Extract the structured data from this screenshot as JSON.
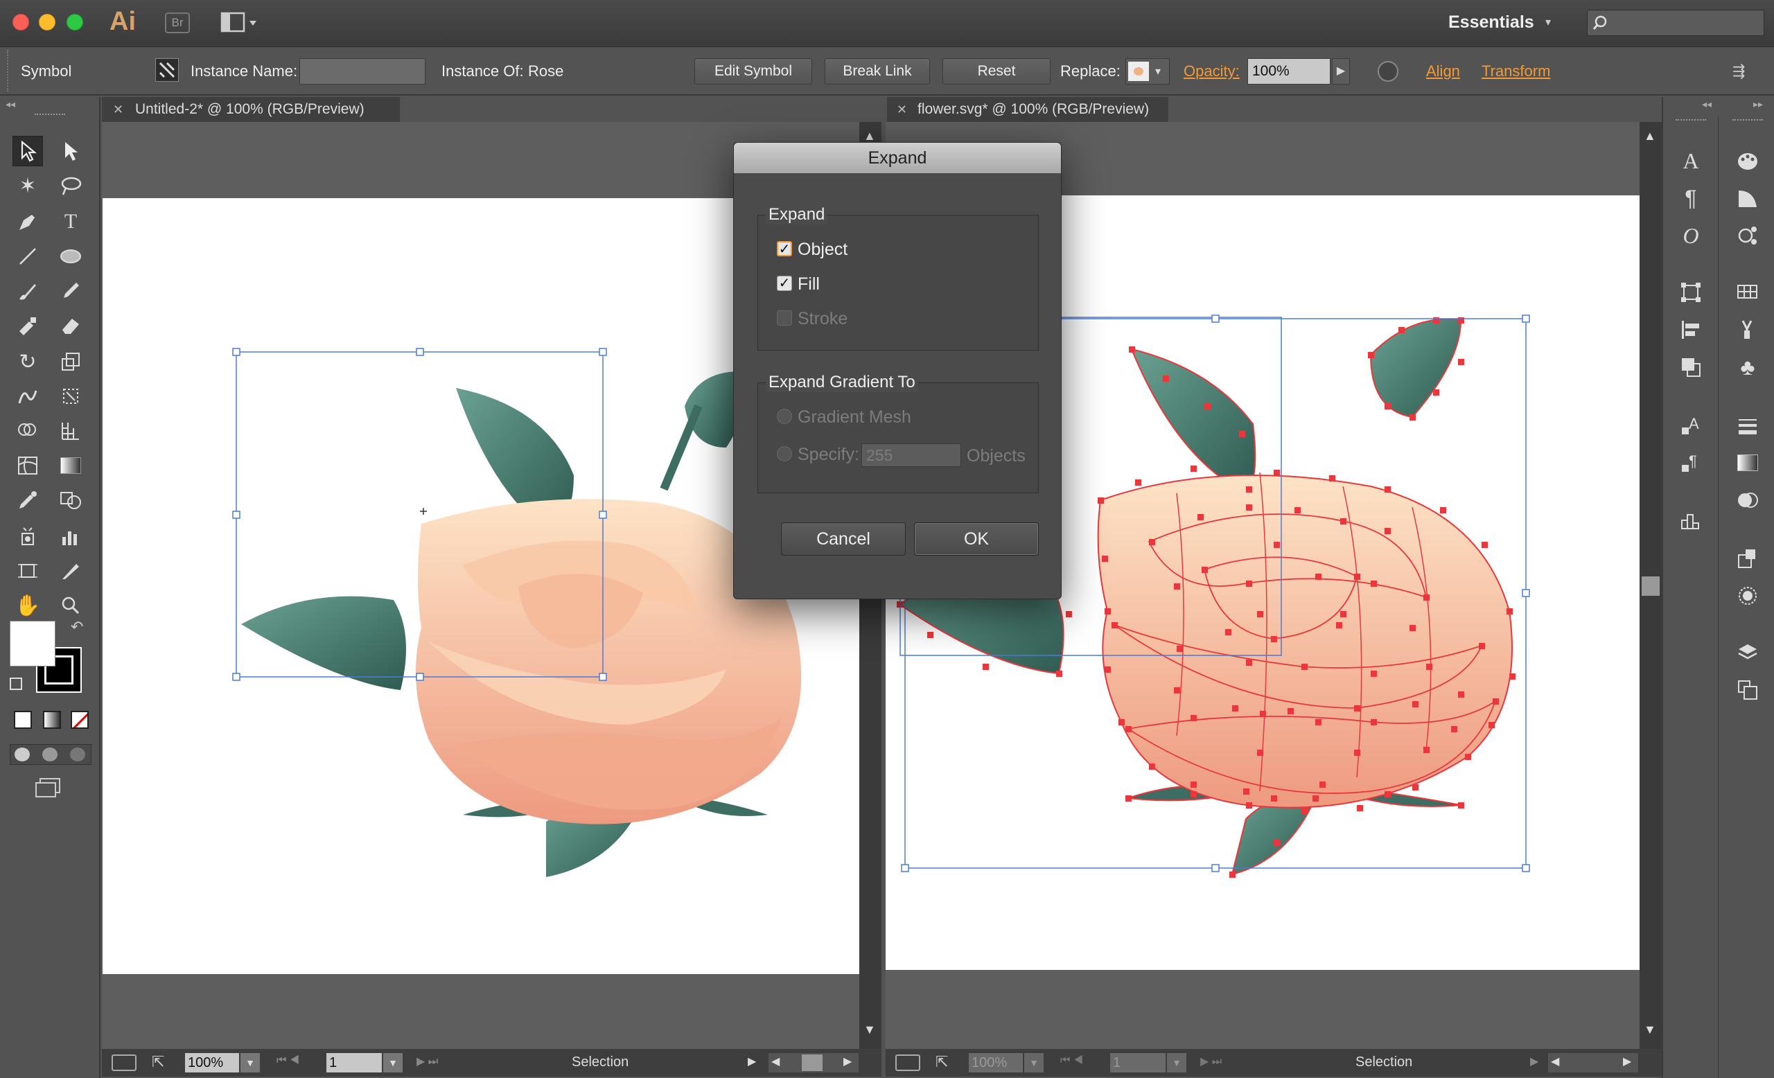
{
  "app": {
    "logo": "Ai",
    "bridge_logo": "Br",
    "workspace": "Essentials"
  },
  "control_bar": {
    "selection_type": "Symbol",
    "instance_name_label": "Instance Name:",
    "instance_name_value": "",
    "instance_of_label": "Instance Of:",
    "instance_of_value": "Rose",
    "edit_symbol": "Edit Symbol",
    "break_link": "Break Link",
    "reset": "Reset",
    "replace_label": "Replace:",
    "opacity_label": "Opacity:",
    "opacity_value": "100%",
    "align": "Align",
    "transform": "Transform"
  },
  "documents": [
    {
      "tab_title": "Untitled-2* @ 100% (RGB/Preview)",
      "zoom": "100%",
      "page": "1",
      "status": "Selection"
    },
    {
      "tab_title": "flower.svg* @ 100% (RGB/Preview)",
      "zoom": "100%",
      "page": "1",
      "status": "Selection"
    }
  ],
  "dialog": {
    "title": "Expand",
    "expand_group": "Expand",
    "object": {
      "label": "Object",
      "checked": true
    },
    "fill": {
      "label": "Fill",
      "checked": true
    },
    "stroke": {
      "label": "Stroke",
      "checked": false
    },
    "gradient_group": "Expand Gradient To",
    "gradient_mesh": "Gradient Mesh",
    "specify": "Specify:",
    "specify_value": "255",
    "objects": "Objects",
    "cancel": "Cancel",
    "ok": "OK"
  },
  "colors": {
    "accent": "#f29a36",
    "selection": "#4a7bd6",
    "anchor": "#e8383c",
    "petal_light": "#fbd5b0",
    "petal_dark": "#ef9b80",
    "leaf": "#3e6e63"
  },
  "icons": {
    "toolbox": [
      "selection-tool-icon",
      "direct-selection-tool-icon",
      "magic-wand-icon",
      "lasso-icon",
      "pen-tool-icon",
      "type-tool-icon",
      "line-tool-icon",
      "ellipse-tool-icon",
      "paintbrush-icon",
      "pencil-icon",
      "blob-brush-icon",
      "eraser-icon",
      "rotate-icon",
      "scale-icon",
      "warp-icon",
      "free-transform-icon",
      "shape-builder-icon",
      "perspective-grid-icon",
      "mesh-icon",
      "gradient-icon",
      "eyedropper-icon",
      "blend-icon",
      "symbol-sprayer-icon",
      "column-graph-icon",
      "artboard-icon",
      "slice-icon",
      "hand-icon",
      "zoom-icon"
    ]
  }
}
